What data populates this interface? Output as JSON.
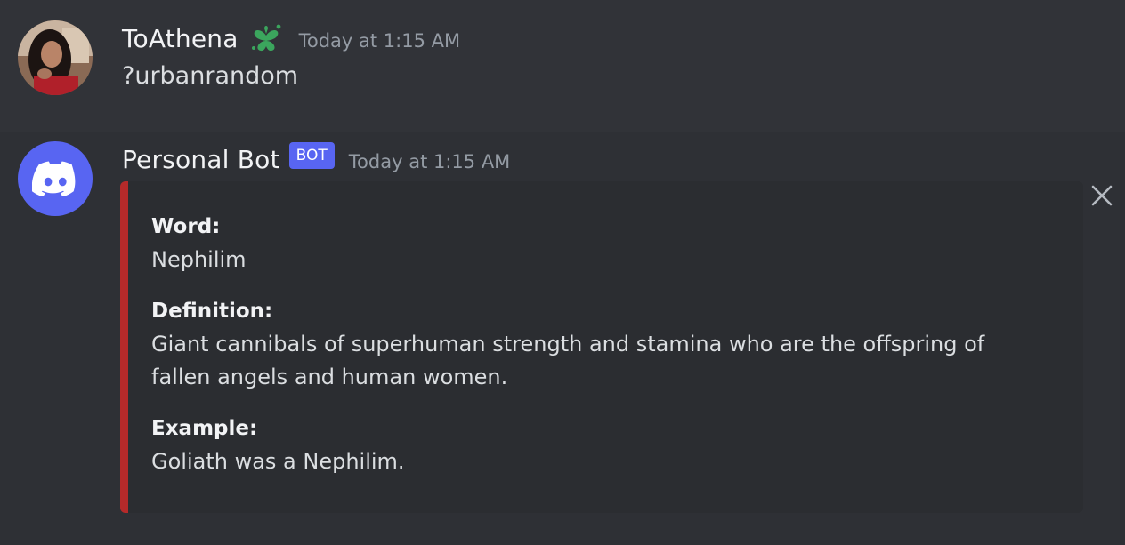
{
  "messages": [
    {
      "username": "ToAthena",
      "timestamp": "Today at 1:15 AM",
      "content": "?urbanrandom",
      "badge_icon": "clover-heart-icon",
      "colors": {
        "badge": "#3ba55d"
      }
    },
    {
      "username": "Personal Bot",
      "tag": "BOT",
      "timestamp": "Today at 1:15 AM",
      "avatar_icon": "discord-logo-icon",
      "colors": {
        "avatar_bg": "#5865f2",
        "embed_accent": "#b52a2a"
      },
      "embed": {
        "fields": [
          {
            "name": "Word:",
            "value": "Nephilim"
          },
          {
            "name": "Definition:",
            "value": "Giant cannibals of superhuman strength and stamina who are the offspring of fallen angels and human women."
          },
          {
            "name": "Example:",
            "value": "Goliath was a Nephilim."
          }
        ],
        "close_icon": "close-icon"
      }
    }
  ]
}
